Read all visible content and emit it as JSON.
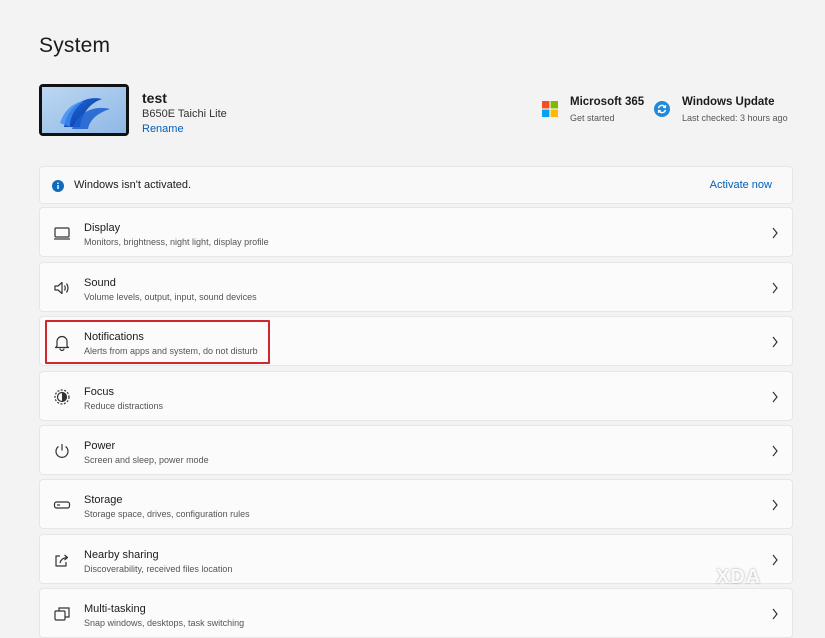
{
  "page": {
    "title": "System"
  },
  "device": {
    "name": "test",
    "model": "B650E Taichi Lite",
    "rename_label": "Rename"
  },
  "quick_links": {
    "microsoft365": {
      "title": "Microsoft 365",
      "subtitle": "Get started"
    },
    "windows_update": {
      "title": "Windows Update",
      "subtitle": "Last checked: 3 hours ago"
    }
  },
  "activation": {
    "message": "Windows isn't activated.",
    "action_label": "Activate now"
  },
  "settings": [
    {
      "title": "Display",
      "subtitle": "Monitors, brightness, night light, display profile",
      "icon": "display-icon"
    },
    {
      "title": "Sound",
      "subtitle": "Volume levels, output, input, sound devices",
      "icon": "speaker-icon"
    },
    {
      "title": "Notifications",
      "subtitle": "Alerts from apps and system, do not disturb",
      "icon": "bell-icon",
      "highlighted": true
    },
    {
      "title": "Focus",
      "subtitle": "Reduce distractions",
      "icon": "focus-icon"
    },
    {
      "title": "Power",
      "subtitle": "Screen and sleep, power mode",
      "icon": "power-icon"
    },
    {
      "title": "Storage",
      "subtitle": "Storage space, drives, configuration rules",
      "icon": "storage-icon"
    },
    {
      "title": "Nearby sharing",
      "subtitle": "Discoverability, received files location",
      "icon": "share-icon"
    },
    {
      "title": "Multi-tasking",
      "subtitle": "Snap windows, desktops, task switching",
      "icon": "multitasking-icon"
    }
  ],
  "watermark": {
    "text": "XDA"
  },
  "colors": {
    "accent": "#005fb8",
    "highlight": "#d0262d",
    "background": "#f3f3f3"
  }
}
